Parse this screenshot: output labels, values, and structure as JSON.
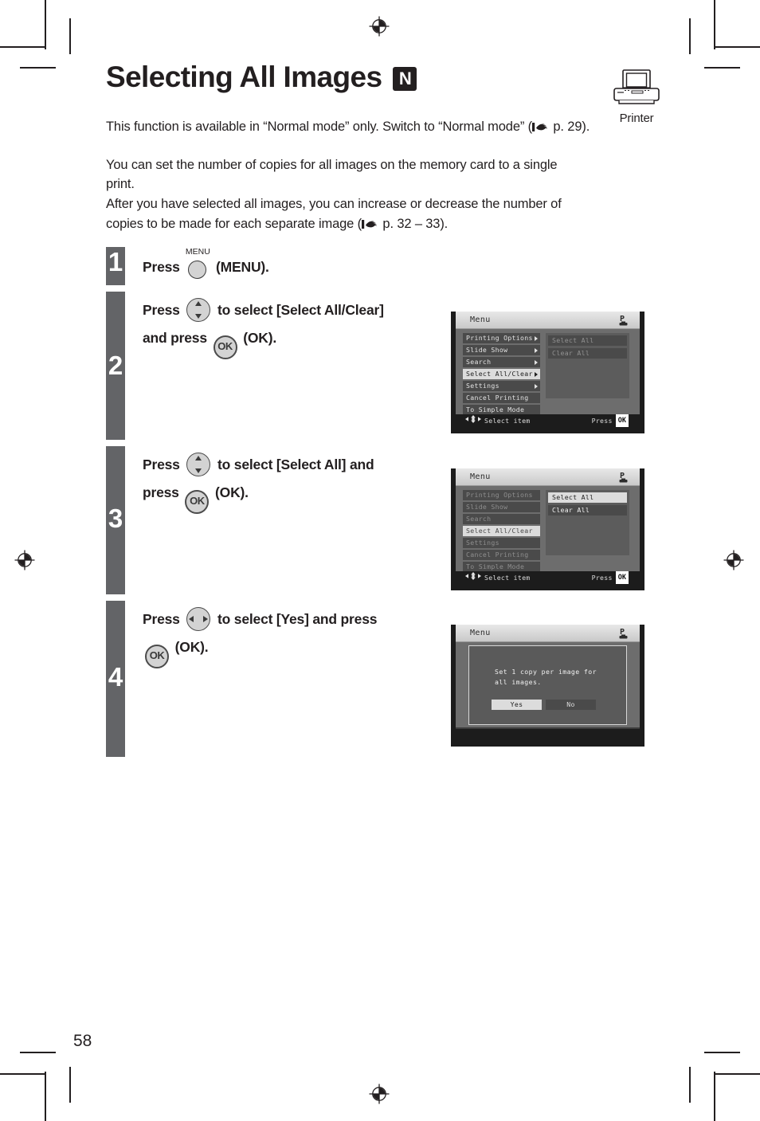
{
  "document": {
    "page_number": "58",
    "title": "Selecting All Images",
    "mode_badge": "N",
    "device_label": "Printer",
    "device_icon": "printer-icon"
  },
  "intro": {
    "availability": "This function is available in “Normal mode” only. Switch to “Normal mode” (",
    "availability_ref": " p. 29).",
    "body_line1": "You can set the number of copies for all images on the memory card to a single",
    "body_line2": "print.",
    "body_line3": "After you have selected all images, you can increase or decrease the number of",
    "body_line4": "copies to be made for each separate image (",
    "body_ref": " p. 32 – 33)."
  },
  "steps": [
    {
      "number": "1",
      "text_before": "Press",
      "key": "MENU",
      "key_label": "MENU",
      "text_after": "(MENU)."
    },
    {
      "number": "2",
      "line1_before": "Press",
      "line1_after": "to select [Select All/Clear]",
      "line2_before": "and press",
      "line2_ok": "OK",
      "line2_after": "(OK)."
    },
    {
      "number": "3",
      "line1_before": "Press",
      "line1_after": "to select [Select All] and",
      "line2_before": "press",
      "line2_ok": "OK",
      "line2_after": "(OK)."
    },
    {
      "number": "4",
      "line1_before": "Press",
      "line1_after": "to select [Yes] and press",
      "line2_ok": "OK",
      "line2_after": "(OK)."
    }
  ],
  "lcd_screens": [
    {
      "id": "screen-step2",
      "title": "Menu",
      "status_icon": "P",
      "menu_items": [
        {
          "label": "Printing Options",
          "has_arrow": true,
          "selected": false
        },
        {
          "label": "Slide Show",
          "has_arrow": true,
          "selected": false
        },
        {
          "label": "Search",
          "has_arrow": true,
          "selected": false
        },
        {
          "label": "Select All/Clear",
          "has_arrow": true,
          "selected": true
        },
        {
          "label": "Settings",
          "has_arrow": true,
          "selected": false
        },
        {
          "label": "Cancel Printing",
          "has_arrow": false,
          "selected": false
        },
        {
          "label": "To Simple Mode",
          "has_arrow": false,
          "selected": false
        }
      ],
      "submenu_items": [
        {
          "label": "Select All",
          "highlighted": false
        },
        {
          "label": "Clear All",
          "highlighted": false
        }
      ],
      "footer_left": "Select item",
      "footer_right": "Press",
      "footer_ok": "OK"
    },
    {
      "id": "screen-step3",
      "title": "Menu",
      "status_icon": "P",
      "menu_items": [
        {
          "label": "Printing Options",
          "has_arrow": false,
          "selected": false
        },
        {
          "label": "Slide Show",
          "has_arrow": false,
          "selected": false
        },
        {
          "label": "Search",
          "has_arrow": false,
          "selected": false
        },
        {
          "label": "Select All/Clear",
          "has_arrow": false,
          "selected": true
        },
        {
          "label": "Settings",
          "has_arrow": false,
          "selected": false
        },
        {
          "label": "Cancel Printing",
          "has_arrow": false,
          "selected": false
        },
        {
          "label": "To Simple Mode",
          "has_arrow": false,
          "selected": false
        }
      ],
      "submenu_items": [
        {
          "label": "Select All",
          "highlighted": true
        },
        {
          "label": "Clear All",
          "highlighted": false
        }
      ],
      "footer_left": "Select item",
      "footer_right": "Press",
      "footer_ok": "OK"
    },
    {
      "id": "screen-step4",
      "title": "Menu",
      "status_icon": "P",
      "dialog_line1": "Set 1 copy per image for",
      "dialog_line2": "all images.",
      "buttons": [
        {
          "label": "Yes",
          "highlighted": true
        },
        {
          "label": "No",
          "highlighted": false
        }
      ]
    }
  ],
  "colors": {
    "text": "#231f20",
    "step_bar": "#636467",
    "lcd_background": "#1c1c1c",
    "lcd_panel": "#6d6d6d",
    "lcd_highlight": "#dcdcdc",
    "badge": "#231f20"
  }
}
